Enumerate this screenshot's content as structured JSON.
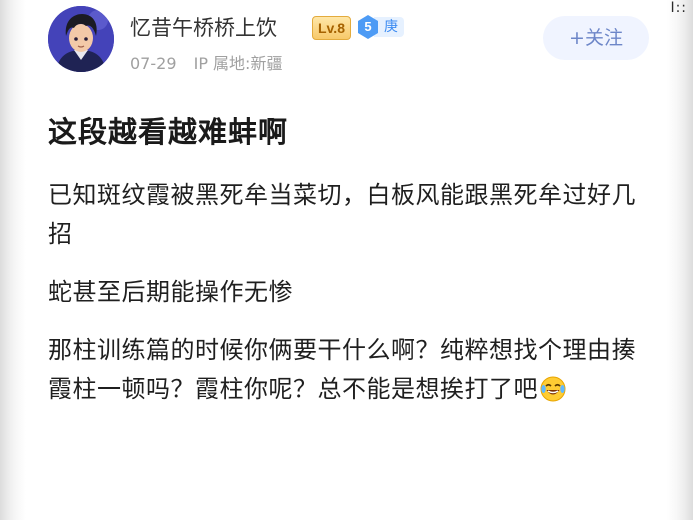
{
  "corner_glyph": "I::",
  "post": {
    "author": {
      "name": "忆昔午桥桥上饮",
      "level_badge": "Lv.8",
      "rank_number": "5",
      "rank_name": "庚"
    },
    "meta": {
      "date": "07-29",
      "ip_location": "IP 属地:新疆"
    },
    "follow_button": "+关注",
    "title": "这段越看越难蚌啊",
    "paragraphs": [
      "已知斑纹霞被黑死牟当菜切，白板风能跟黑死牟过好几招",
      "蛇甚至后期能操作无惨",
      "那柱训练篇的时候你俩要干什么啊？纯粹想找个理由揍霞柱一顿吗？霞柱你呢？总不能是想挨打了吧"
    ],
    "trailing_emoji": "laughing-crying-emoji"
  },
  "colors": {
    "accent": "#3d8cf2",
    "level_badge": "#f7c96a",
    "follow_bg": "#f0f4ff"
  }
}
